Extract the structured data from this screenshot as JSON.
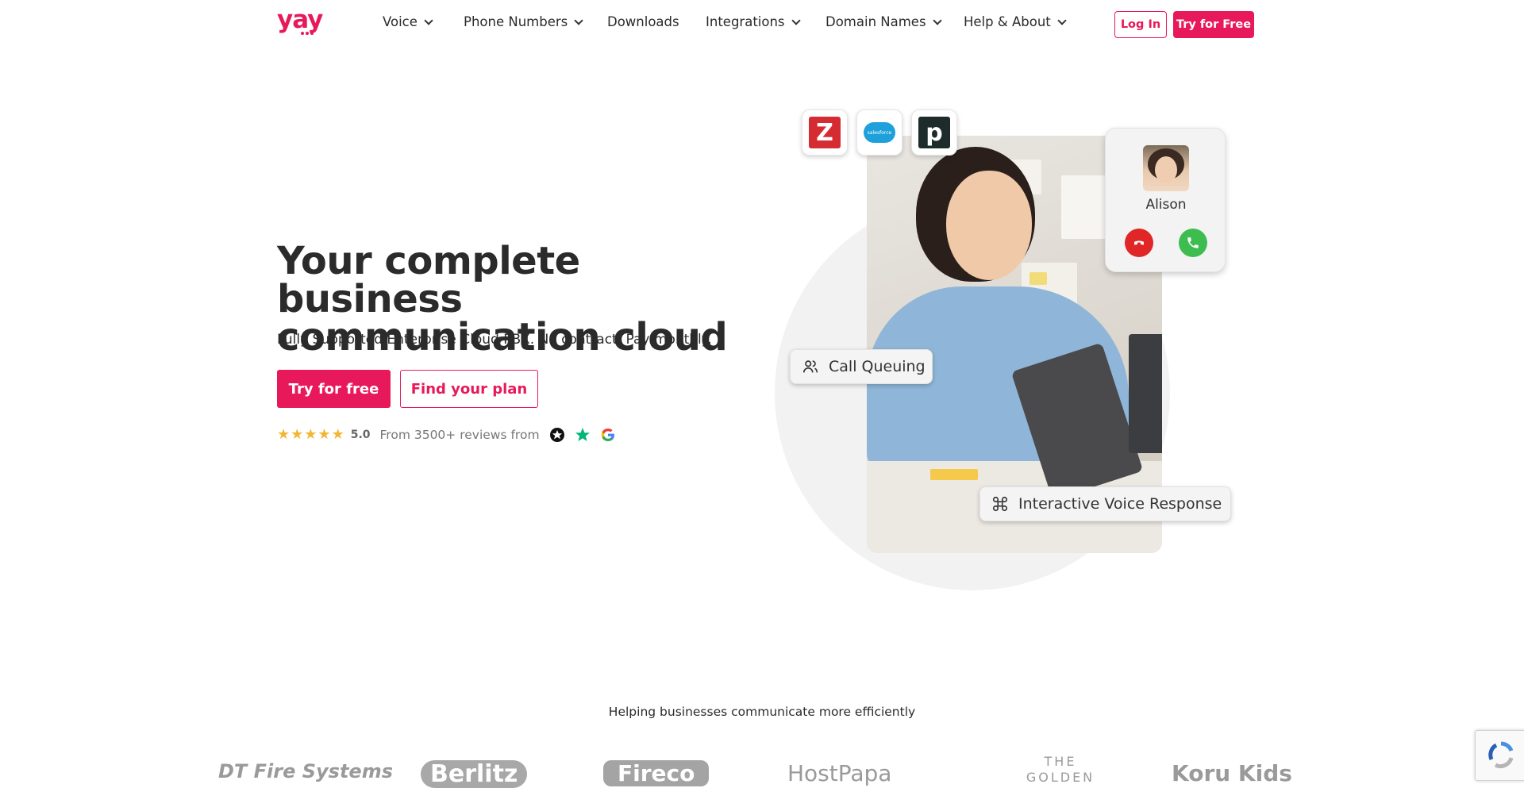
{
  "nav": {
    "logo": "yay",
    "items": [
      {
        "label": "Voice",
        "has_dropdown": true
      },
      {
        "label": "Phone Numbers",
        "has_dropdown": true
      },
      {
        "label": "Downloads",
        "has_dropdown": false
      },
      {
        "label": "Integrations",
        "has_dropdown": true
      },
      {
        "label": "Domain Names",
        "has_dropdown": true
      },
      {
        "label": "Help & About",
        "has_dropdown": true
      }
    ],
    "login_label": "Log In",
    "try_label": "Try for Free"
  },
  "hero": {
    "title_line1": "Your complete business",
    "title_line2": "communication cloud",
    "subtitle": "Fully Supported Enterprise Cloud PBX. No contract, Pay monthly.",
    "cta_primary": "Try for free",
    "cta_secondary": "Find your plan",
    "rating_stars": 5,
    "rating_value": "5.0",
    "review_text": "From 3500+ reviews from",
    "review_icons": [
      "reviews-io-icon",
      "trustpilot-star-icon",
      "google-g-icon"
    ]
  },
  "visual": {
    "integrations": [
      "zendesk-icon",
      "salesforce-icon",
      "pipedrive-icon"
    ],
    "salesforce_text": "salesforce",
    "caller_name": "Alison",
    "feature_pill_1": "Call Queuing",
    "feature_pill_2": "Interactive Voice Response"
  },
  "clients": {
    "heading": "Helping businesses communicate more efficiently",
    "logos": [
      "DT Fire Systems",
      "Berlitz",
      "Fireco",
      "HostPapa",
      "THE GOLDEN",
      "Koru Kids"
    ]
  },
  "colors": {
    "brand": "#e8195a",
    "star": "#f2b632",
    "decline": "#e02626",
    "accept": "#3dbd4f"
  }
}
